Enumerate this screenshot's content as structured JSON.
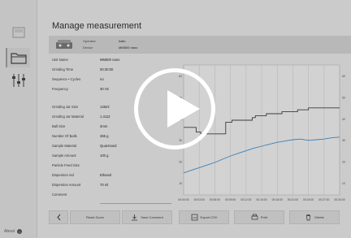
{
  "page": {
    "title": "Manage measurement"
  },
  "device": {
    "operator_label": "Operator",
    "operator_value": "hallo",
    "device_label": "Device",
    "device_value": "MM500 nano"
  },
  "properties": [
    {
      "key": "Unit Name",
      "value": "MM500 nano"
    },
    {
      "key": "Grinding Time",
      "value": "00:30:00"
    },
    {
      "key": "Sequence • Cycles",
      "value": "no"
    },
    {
      "key": "Frequency",
      "value": "30 Hz"
    },
    {
      "key": "Grinding Jar Size",
      "value": "125ml"
    },
    {
      "key": "Grinding Jar Material",
      "value": "1.4112"
    },
    {
      "key": "Ball Size",
      "value": "3mm"
    },
    {
      "key": "Number Of Balls",
      "value": "365 g"
    },
    {
      "key": "Sample Material",
      "value": "Quarzsand"
    },
    {
      "key": "Sample Amount",
      "value": "100 g"
    },
    {
      "key": "Particle Feed Size",
      "value": ""
    },
    {
      "key": "Dispersion Aid",
      "value": "Ethanol"
    },
    {
      "key": "Dispersion Amount",
      "value": "70 ml"
    },
    {
      "key": "Comment",
      "value": ""
    }
  ],
  "toolbar": {
    "back_label": "Reset Zoom",
    "save_comment_label": "Save Comment",
    "export_label": "Export CSV",
    "print_label": "Print",
    "delete_label": "Delete"
  },
  "about": {
    "label": "About"
  },
  "chart_data": {
    "type": "line",
    "x_ticks": [
      "00:00:00",
      "00:03:00",
      "00:06:00",
      "00:09:00",
      "00:12:00",
      "00:15:00",
      "00:18:00",
      "00:21:00",
      "00:24:00",
      "00:27:00",
      "00:30:00"
    ],
    "y_left_ticks": [
      "60",
      "50",
      "40",
      "30",
      "20",
      "10"
    ],
    "series": [
      {
        "name": "",
        "color": "#3c3c3c",
        "points": [
          [
            0,
            52
          ],
          [
            8,
            52
          ],
          [
            8,
            48.5
          ],
          [
            11,
            48.5
          ],
          [
            11,
            47
          ],
          [
            27,
            47
          ],
          [
            27,
            56
          ],
          [
            31,
            56
          ],
          [
            31,
            57.5
          ],
          [
            44,
            57.5
          ],
          [
            44,
            59.5
          ],
          [
            46,
            59.5
          ],
          [
            46,
            61
          ],
          [
            53,
            61
          ],
          [
            53,
            62.5
          ],
          [
            63,
            62.5
          ],
          [
            63,
            64
          ],
          [
            73,
            64
          ],
          [
            73,
            65.5
          ],
          [
            80,
            65.5
          ],
          [
            80,
            67
          ],
          [
            100,
            67
          ]
        ]
      },
      {
        "name": "",
        "color": "#3b7fb8",
        "points": [
          [
            0,
            17
          ],
          [
            5,
            19
          ],
          [
            10,
            21
          ],
          [
            15,
            23
          ],
          [
            20,
            25
          ],
          [
            25,
            27.5
          ],
          [
            30,
            30
          ],
          [
            35,
            32
          ],
          [
            40,
            34
          ],
          [
            45,
            36
          ],
          [
            50,
            37.5
          ],
          [
            55,
            39
          ],
          [
            60,
            40.5
          ],
          [
            65,
            41.5
          ],
          [
            70,
            42.5
          ],
          [
            75,
            43
          ],
          [
            80,
            42
          ],
          [
            85,
            42.5
          ],
          [
            90,
            43
          ],
          [
            95,
            44
          ],
          [
            100,
            44.5
          ]
        ]
      }
    ]
  }
}
